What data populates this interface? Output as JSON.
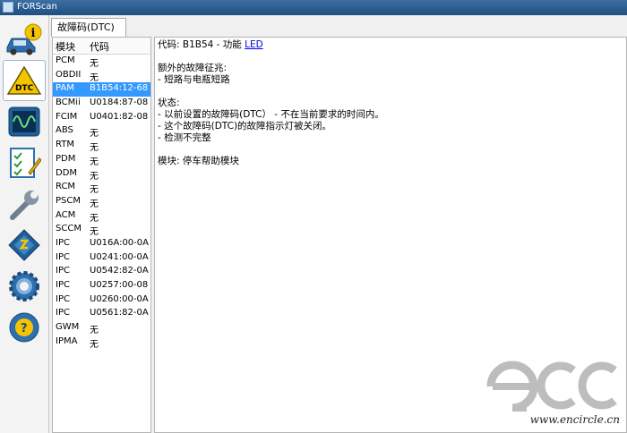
{
  "window": {
    "title": "FORScan"
  },
  "toolbar": {
    "items": [
      {
        "icon": "car-info-icon",
        "label": "vehicle info"
      },
      {
        "icon": "dtc-icon",
        "label": "DTC",
        "active": true
      },
      {
        "icon": "oscilloscope-icon",
        "label": "PID monitor"
      },
      {
        "icon": "checklist-icon",
        "label": "tests"
      },
      {
        "icon": "wrench-icon",
        "label": "service"
      },
      {
        "icon": "chip-icon",
        "label": "configuration"
      },
      {
        "icon": "gear-icon",
        "label": "settings"
      },
      {
        "icon": "help-icon",
        "label": "help"
      }
    ]
  },
  "tab": {
    "label": "故障码(DTC)"
  },
  "module_list": {
    "headers": [
      "模块",
      "代码"
    ],
    "rows": [
      [
        "PCM",
        "无"
      ],
      [
        "OBDII",
        "无"
      ],
      [
        "PAM",
        "B1B54:12-68"
      ],
      [
        "BCMii",
        "U0184:87-08"
      ],
      [
        "FCIM",
        "U0401:82-08"
      ],
      [
        "ABS",
        "无"
      ],
      [
        "RTM",
        "无"
      ],
      [
        "PDM",
        "无"
      ],
      [
        "DDM",
        "无"
      ],
      [
        "RCM",
        "无"
      ],
      [
        "PSCM",
        "无"
      ],
      [
        "ACM",
        "无"
      ],
      [
        "SCCM",
        "无"
      ],
      [
        "IPC",
        "U016A:00-0A"
      ],
      [
        "IPC",
        "U0241:00-0A"
      ],
      [
        "IPC",
        "U0542:82-0A"
      ],
      [
        "IPC",
        "U0257:00-08"
      ],
      [
        "IPC",
        "U0260:00-0A"
      ],
      [
        "IPC",
        "U0561:82-0A"
      ],
      [
        "GWM",
        "无"
      ],
      [
        "IPMA",
        "无"
      ]
    ],
    "selected_index": 2
  },
  "detail": {
    "code_prefix": "代码: B1B54 - 功能 ",
    "code_link": "LED",
    "extra_title": "额外的故障征兆:",
    "extra_item": " - 短路与电瓶短路",
    "status_title": "状态:",
    "status_items": [
      " - 以前设置的故障码(DTC） - 不在当前要求的时间内。",
      " - 这个故障码(DTC)的故障指示灯被关闭。",
      " - 检测不完整"
    ],
    "module_line": "模块: 停车帮助模块"
  },
  "watermark": {
    "logo_text": "ecc",
    "site": "www.encircle.cn"
  },
  "colors": {
    "selection": "#3399ff",
    "titlebar": "#2a5b8e",
    "link": "#0000ee"
  }
}
